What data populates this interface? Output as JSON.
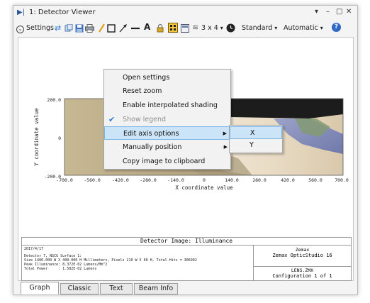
{
  "window": {
    "title": "1: Detector Viewer",
    "controls": {
      "dropdown": "▾",
      "minimize": "–",
      "maximize": "□",
      "close": "✕"
    }
  },
  "toolbar": {
    "settings_label": "Settings",
    "layout_label": "3 x 4",
    "layout_arrow": "▾",
    "standard_label": "Standard",
    "standard_arrow": "▾",
    "automatic_label": "Automatic",
    "automatic_arrow": "▾",
    "help_glyph": "?"
  },
  "plot": {
    "xlabel": "X coordinate value",
    "ylabel": "Y coordinate value",
    "x_ticks": [
      "-700.0",
      "-560.0",
      "-420.0",
      "-280.0",
      "-140.0",
      "0",
      "140.0",
      "280.0",
      "420.0",
      "560.0",
      "700.0"
    ],
    "y_ticks": [
      "200.0",
      "0",
      "-200.0"
    ],
    "colors": {
      "dark": "#171717",
      "tan": "#b9aa86",
      "light": "#ede2ce",
      "blue": "#8790bc",
      "green": "#7e9a73"
    }
  },
  "context_menu": {
    "items": [
      {
        "label": "Open settings",
        "disabled": false,
        "checked": false,
        "submenu": false,
        "highlighted": false
      },
      {
        "label": "Reset zoom",
        "disabled": false,
        "checked": false,
        "submenu": false,
        "highlighted": false
      },
      {
        "label": "Enable interpolated shading",
        "disabled": false,
        "checked": false,
        "submenu": false,
        "highlighted": false
      },
      {
        "label": "Show legend",
        "disabled": true,
        "checked": true,
        "submenu": false,
        "highlighted": false
      },
      {
        "label": "Edit axis options",
        "disabled": false,
        "checked": false,
        "submenu": true,
        "highlighted": true
      },
      {
        "label": "Manually position",
        "disabled": false,
        "checked": false,
        "submenu": true,
        "highlighted": false
      },
      {
        "label": "Copy image to clipboard",
        "disabled": false,
        "checked": false,
        "submenu": false,
        "highlighted": false
      }
    ],
    "submenu_items": [
      {
        "label": "X",
        "highlighted": true
      },
      {
        "label": "Y",
        "highlighted": false
      }
    ],
    "arrow_glyph": "▶",
    "check_glyph": "✔"
  },
  "info": {
    "heading": "Detector Image: Illuminance",
    "date": "2017/4/17",
    "lines": [
      "Detector 7, NSCG Surface 1:",
      "Size 1400.000 W X 400.000 H Millimeters, Pixels 210 W X 60 H, Total Hits = 306902",
      "Peak Illuminance: 8.372E-02 Lumens/Mm^2",
      "Total Power     : 1.582E-02 Lumens"
    ],
    "company": "Zemax",
    "product": "Zemax OpticStudio 16",
    "file": "LENS.ZMX",
    "configuration": "Configuration 1 of 1"
  },
  "tabs": [
    "Graph",
    "Classic",
    "Text",
    "Beam Info"
  ],
  "active_tab": "Graph"
}
